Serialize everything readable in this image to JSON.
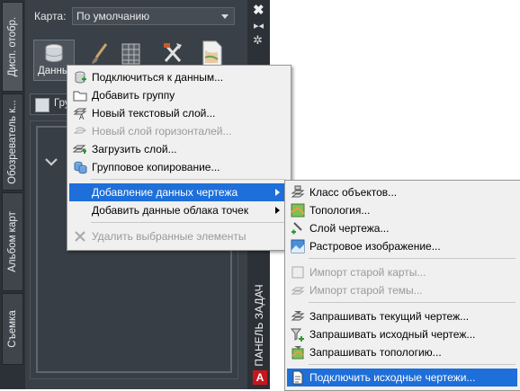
{
  "taskpane": {
    "map_label": "Карта:",
    "map_select": "По умолчанию",
    "tabs": [
      "Дисп. отобр.",
      "Обозреватель к...",
      "Альбом карт",
      "Съемка"
    ],
    "data_button": "Данные",
    "group_button": "Гру",
    "panel_title": "ПАНЕЛЬ ЗАДАЧ",
    "close_glyph": "✖",
    "autohide_glyph": "▸◂",
    "settings_glyph": "✲",
    "logo_letter": "A"
  },
  "menu": {
    "items": [
      {
        "label": "Подключиться к данным...",
        "icon": "database-connect-icon",
        "disabled": false
      },
      {
        "label": "Добавить группу",
        "icon": "folder-icon",
        "disabled": false
      },
      {
        "label": "Новый текстовый слой...",
        "icon": "text-layer-icon",
        "disabled": false
      },
      {
        "label": "Новый слой горизонталей...",
        "icon": "contour-layer-icon",
        "disabled": true
      },
      {
        "label": "Загрузить слой...",
        "icon": "load-layer-icon",
        "disabled": false
      },
      {
        "label": "Групповое копирование...",
        "icon": "bulk-copy-icon",
        "disabled": false
      },
      {
        "label": "Добавление данных чертежа",
        "icon": "",
        "disabled": false,
        "submenu": true,
        "highlighted": true
      },
      {
        "label": "Добавить данные облака точек",
        "icon": "",
        "disabled": false,
        "submenu": true
      },
      {
        "label": "Удалить выбранные элементы",
        "icon": "delete-icon",
        "disabled": true
      }
    ]
  },
  "submenu": {
    "items": [
      {
        "label": "Класс объектов...",
        "icon": "feature-class-icon",
        "disabled": false
      },
      {
        "label": "Топология...",
        "icon": "topology-icon",
        "disabled": false
      },
      {
        "label": "Слой чертежа...",
        "icon": "drawing-layer-icon",
        "disabled": false
      },
      {
        "label": "Растровое изображение...",
        "icon": "raster-image-icon",
        "disabled": false
      },
      {
        "label": "Импорт старой карты...",
        "icon": "import-old-map-icon",
        "disabled": true
      },
      {
        "label": "Импорт старой темы...",
        "icon": "import-old-theme-icon",
        "disabled": true
      },
      {
        "label": "Запрашивать текущий чертеж...",
        "icon": "query-current-drawing-icon",
        "disabled": false
      },
      {
        "label": "Запрашивать исходный чертеж...",
        "icon": "query-source-drawing-icon",
        "disabled": false
      },
      {
        "label": "Запрашивать топологию...",
        "icon": "query-topology-icon",
        "disabled": false
      },
      {
        "label": "Подключить исходные чертежи...",
        "icon": "attach-source-drawings-icon",
        "disabled": false,
        "highlighted": true
      }
    ]
  },
  "colors": {
    "highlight": "#1e6fd9",
    "pane_bg": "#3a4047",
    "menu_bg": "#f0f0f0"
  }
}
